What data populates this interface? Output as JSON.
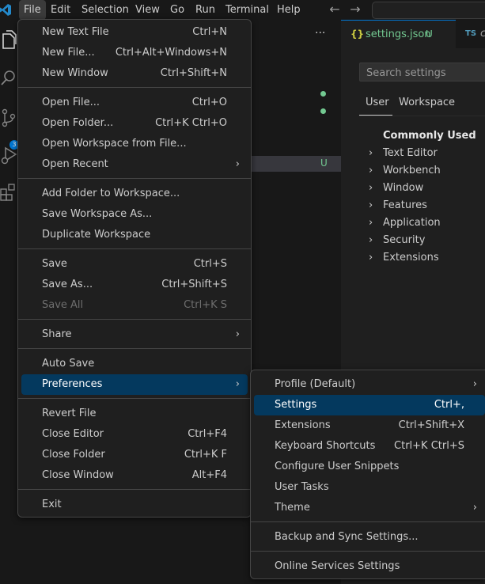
{
  "colors": {
    "accent": "#0078d4",
    "menu_highlight": "#04395e",
    "git_untracked": "#73c991",
    "json_icon": "#cbcb41",
    "ts_icon": "#519aba"
  },
  "menubar": {
    "items": [
      "File",
      "Edit",
      "Selection",
      "View",
      "Go",
      "Run",
      "Terminal",
      "Help"
    ],
    "active": "File"
  },
  "activity": {
    "scm_badge": "3",
    "icons": [
      "explorer-icon",
      "search-icon",
      "source-control-icon",
      "run-debug-icon",
      "extensions-icon"
    ]
  },
  "sidebar": {
    "more_actions": "···",
    "untracked_marker": "U"
  },
  "tabs": [
    {
      "icon": "{}",
      "label": "settings.json",
      "status": "U"
    },
    {
      "icon": "TS",
      "label": "c"
    }
  ],
  "settings": {
    "search_placeholder": "Search settings",
    "scopes": [
      "User",
      "Workspace"
    ],
    "toc_heading": "Commonly Used",
    "toc": [
      "Text Editor",
      "Workbench",
      "Window",
      "Features",
      "Application",
      "Security",
      "Extensions"
    ]
  },
  "file_menu": [
    {
      "label": "New Text File",
      "key": "Ctrl+N"
    },
    {
      "label": "New File...",
      "key": "Ctrl+Alt+Windows+N"
    },
    {
      "label": "New Window",
      "key": "Ctrl+Shift+N"
    },
    {
      "label": "Open File...",
      "key": "Ctrl+O"
    },
    {
      "label": "Open Folder...",
      "key": "Ctrl+K Ctrl+O"
    },
    {
      "label": "Open Workspace from File...",
      "key": ""
    },
    {
      "label": "Open Recent",
      "key": "",
      "submenu": true
    },
    {
      "label": "Add Folder to Workspace...",
      "key": ""
    },
    {
      "label": "Save Workspace As...",
      "key": ""
    },
    {
      "label": "Duplicate Workspace",
      "key": ""
    },
    {
      "label": "Save",
      "key": "Ctrl+S"
    },
    {
      "label": "Save As...",
      "key": "Ctrl+Shift+S"
    },
    {
      "label": "Save All",
      "key": "Ctrl+K S",
      "disabled": true
    },
    {
      "label": "Share",
      "key": "",
      "submenu": true
    },
    {
      "label": "Auto Save",
      "key": ""
    },
    {
      "label": "Preferences",
      "key": "",
      "submenu": true,
      "highlighted": true
    },
    {
      "label": "Revert File",
      "key": ""
    },
    {
      "label": "Close Editor",
      "key": "Ctrl+F4"
    },
    {
      "label": "Close Folder",
      "key": "Ctrl+K F"
    },
    {
      "label": "Close Window",
      "key": "Alt+F4"
    },
    {
      "label": "Exit",
      "key": ""
    }
  ],
  "preferences_menu": [
    {
      "label": "Profile (Default)",
      "key": "",
      "submenu": true
    },
    {
      "label": "Settings",
      "key": "Ctrl+,",
      "highlighted": true
    },
    {
      "label": "Extensions",
      "key": "Ctrl+Shift+X"
    },
    {
      "label": "Keyboard Shortcuts",
      "key": "Ctrl+K Ctrl+S"
    },
    {
      "label": "Configure User Snippets",
      "key": ""
    },
    {
      "label": "User Tasks",
      "key": ""
    },
    {
      "label": "Theme",
      "key": "",
      "submenu": true
    },
    {
      "label": "Backup and Sync Settings...",
      "key": ""
    },
    {
      "label": "Online Services Settings",
      "key": ""
    }
  ],
  "submenu_glyph": "›",
  "chevron_glyph": "›"
}
